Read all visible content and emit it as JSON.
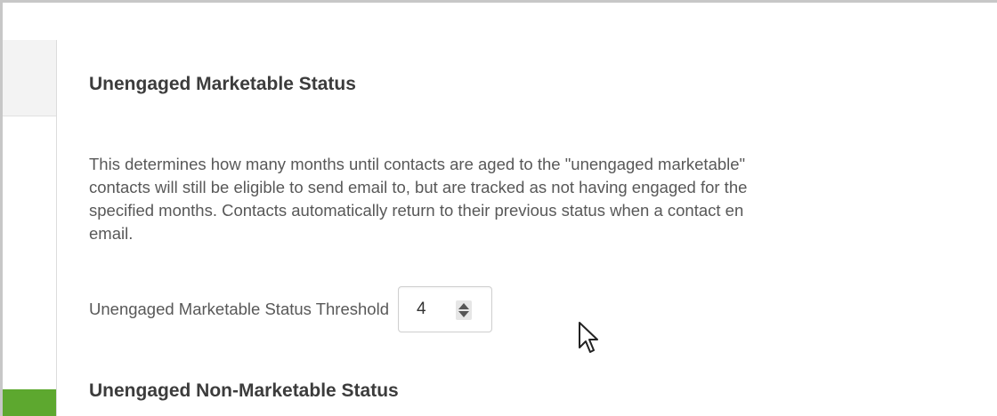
{
  "sections": [
    {
      "title": "Unengaged Marketable Status",
      "description_lines": [
        "This determines how many months until contacts are aged to the \"unengaged marketable\"",
        "contacts will still be eligible to send email to, but are tracked as not having engaged for the",
        "specified months. Contacts automatically return to their previous status when a contact en",
        "email."
      ],
      "threshold": {
        "label": "Unengaged Marketable Status Threshold",
        "value": "4"
      }
    },
    {
      "title": "Unengaged Non-Marketable Status"
    }
  ],
  "icons": {
    "spinner": "up-down-spinner-icon",
    "cursor": "mouse-pointer-icon"
  },
  "colors": {
    "active_tab": "#5da82f",
    "heading_text": "#3c3c3c",
    "body_text": "#585858"
  }
}
